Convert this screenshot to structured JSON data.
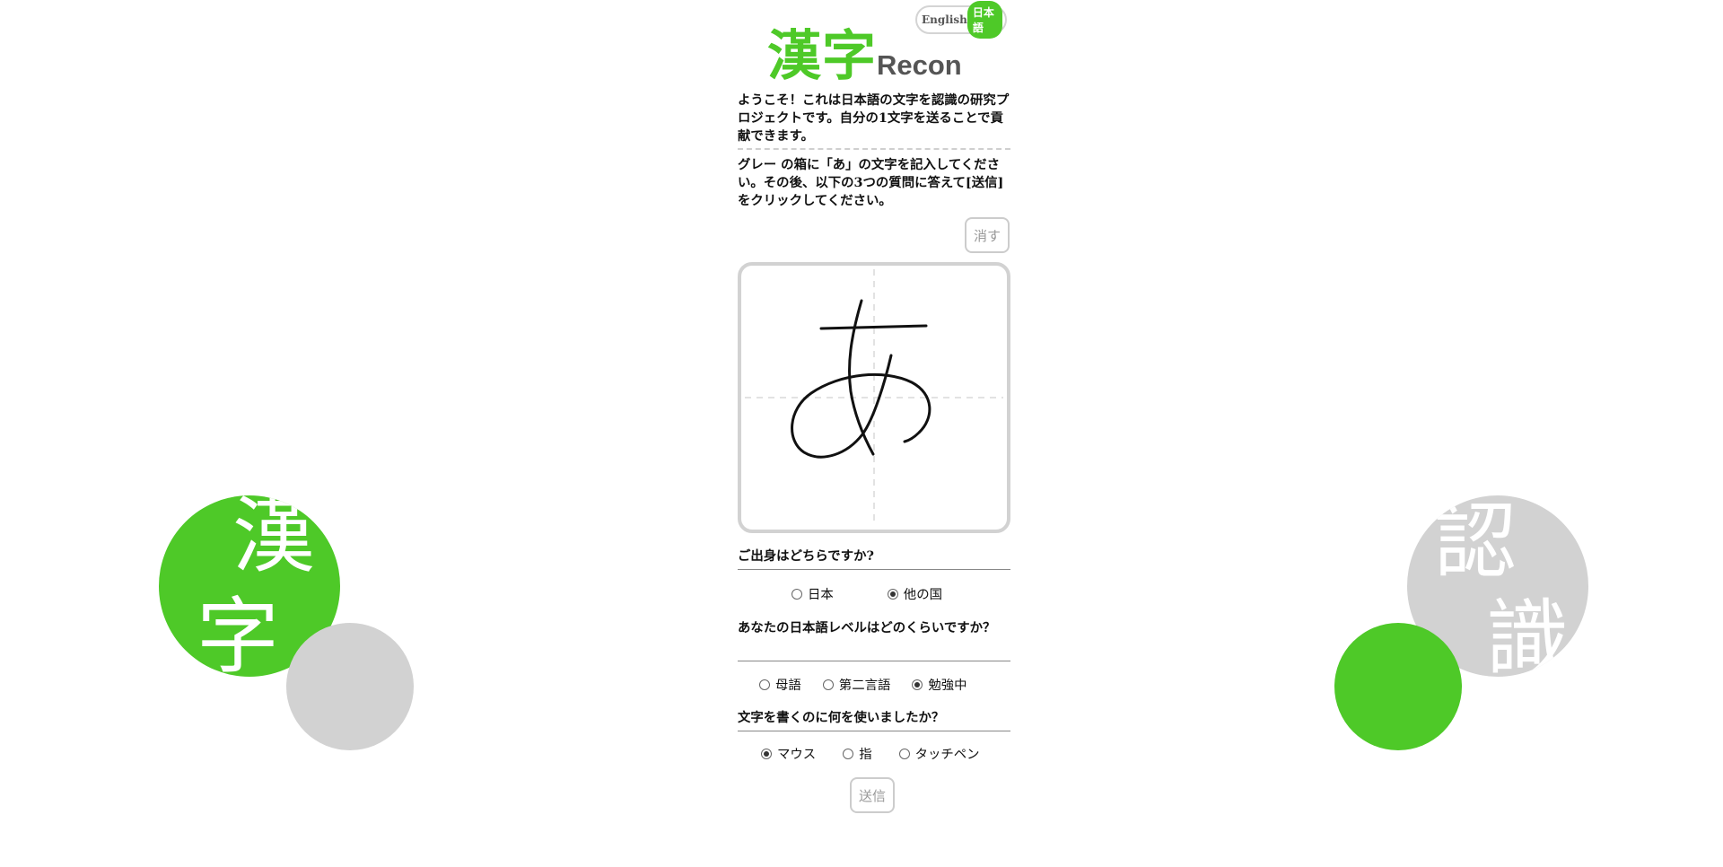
{
  "brand": {
    "logo_kanji": "漢字",
    "logo_text": "Recon",
    "accent": "#4ec928",
    "gray": "#d2d2d2"
  },
  "language": {
    "english_label": "English",
    "japanese_label": "日本語",
    "selected": "日本語"
  },
  "intro": "ようこそ！これは日本語の文字を認識の研究プロジェクトです。自分の1文字を送ることで貢献できます。",
  "instructions": "グレー の箱に「あ」の文字を記入してください。その後、以下の3つの質問に答えて[送信]をクリックしてください。",
  "clear_button": "消す",
  "submit_button": "送信",
  "questions": [
    {
      "text": "ご出身はどちらですか?",
      "options": [
        "日本",
        "他の国"
      ],
      "selected": 1
    },
    {
      "text": "あなたの日本語レベルはどのくらいですか？",
      "options": [
        "母語",
        "第二言語",
        "勉強中"
      ],
      "selected": 2
    },
    {
      "text": "文字を書くのに何を使いましたか？",
      "options": [
        "マウス",
        "指",
        "タッチペン"
      ],
      "selected": 0
    }
  ],
  "decor": {
    "left_chars": [
      "漢",
      "字"
    ],
    "right_chars": [
      "認",
      "識"
    ]
  }
}
